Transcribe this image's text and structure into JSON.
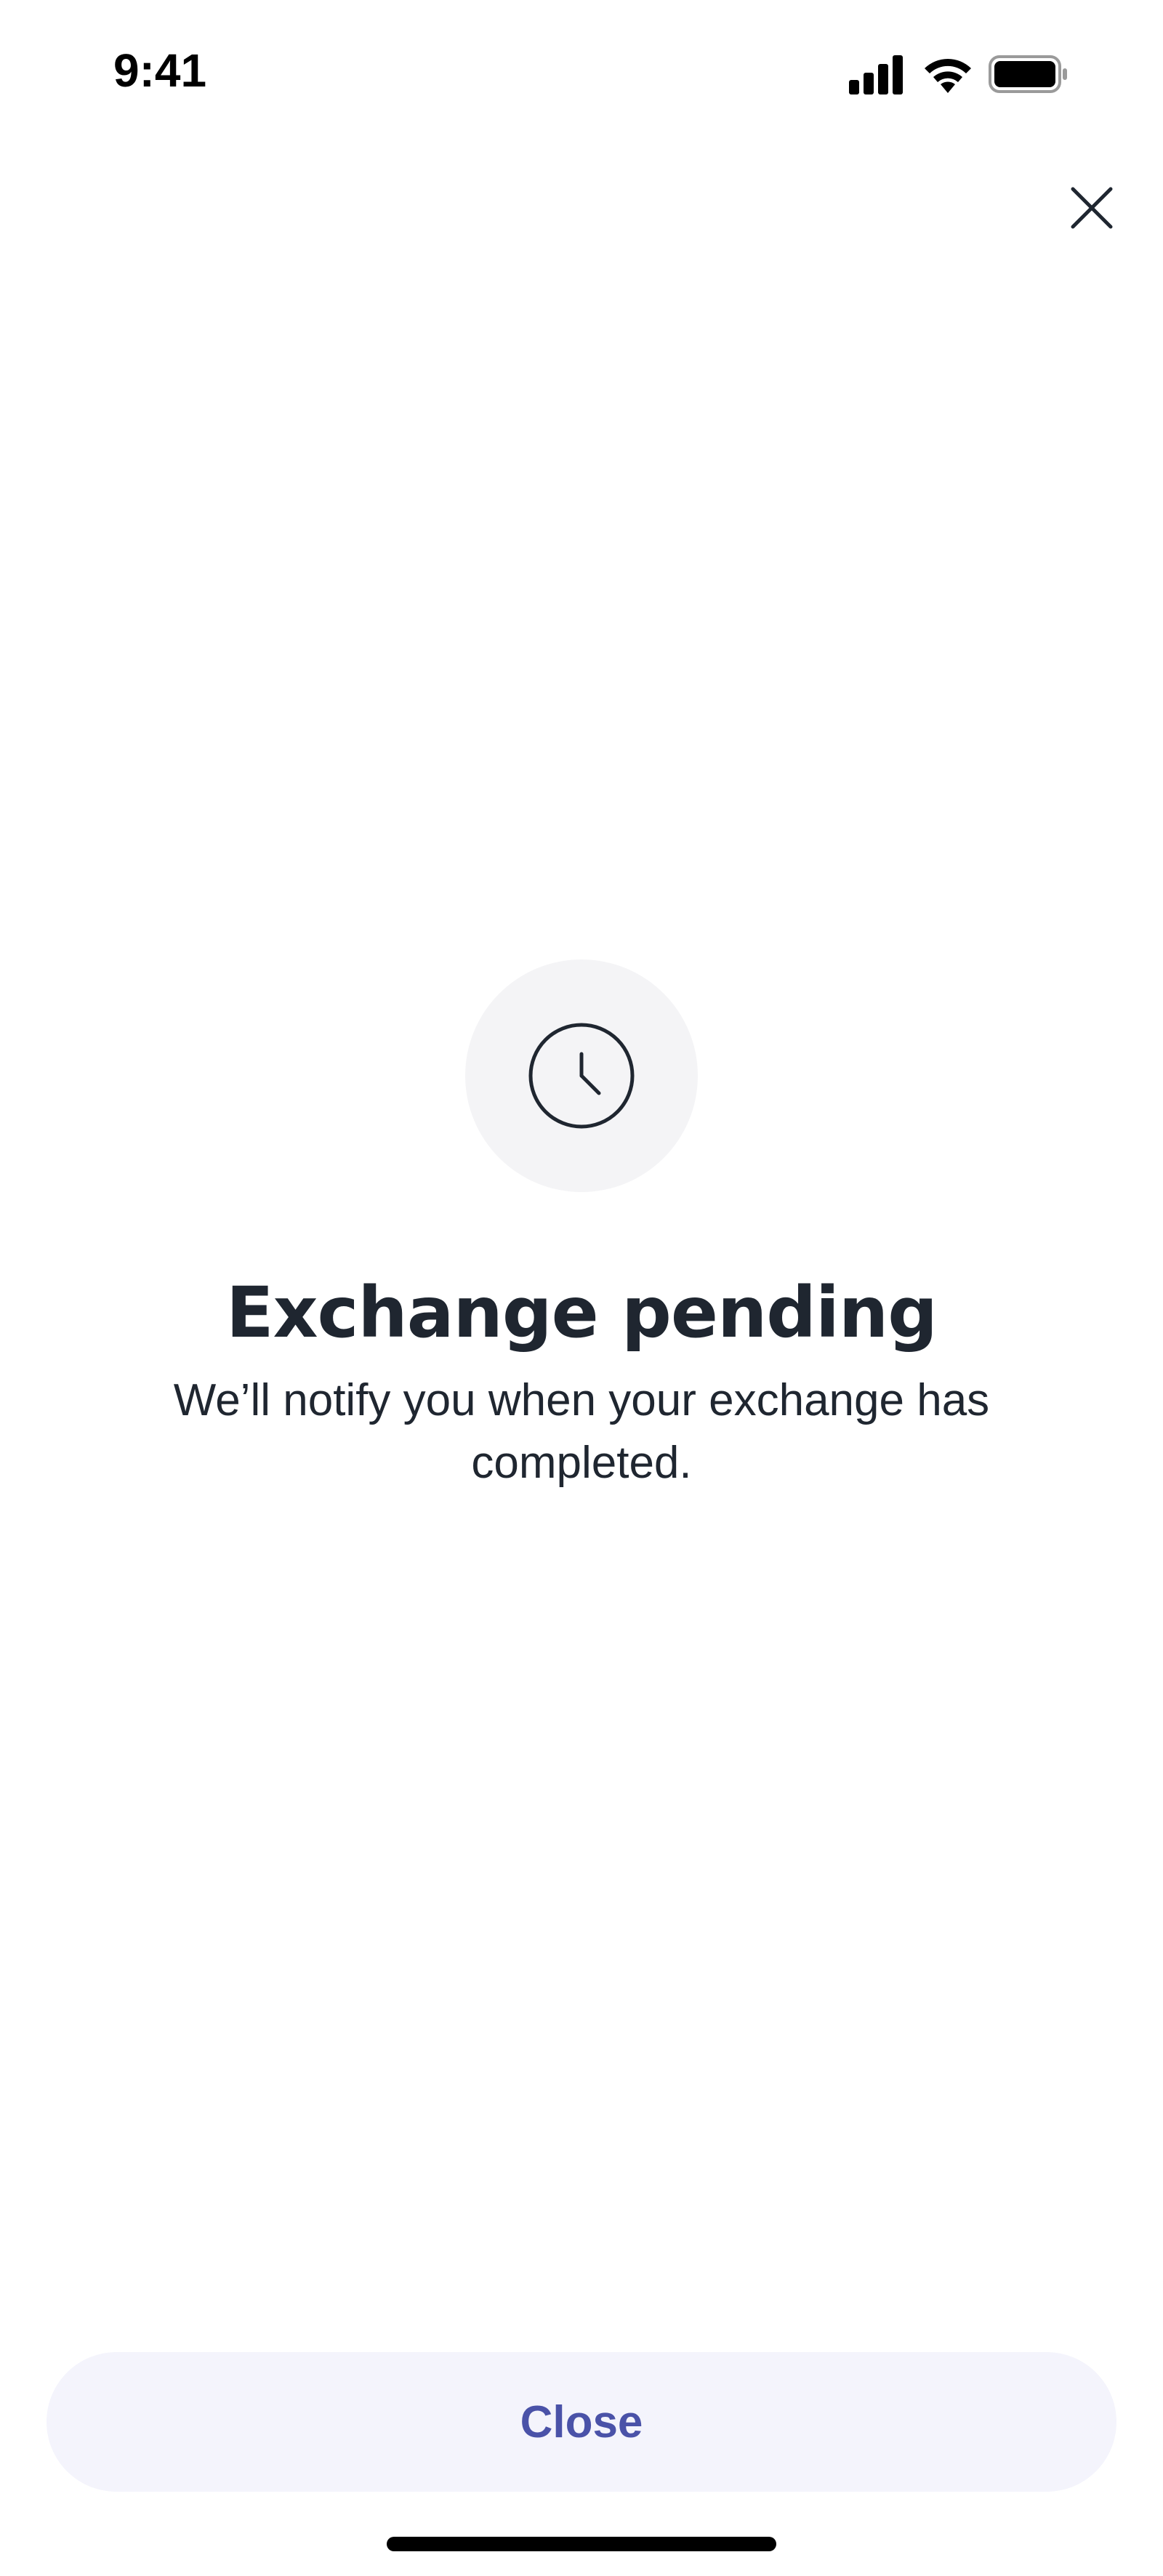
{
  "status_bar": {
    "time": "9:41",
    "icons": [
      "cellular-signal-icon",
      "wifi-icon",
      "battery-icon"
    ]
  },
  "header": {
    "close_icon": "close-icon"
  },
  "main": {
    "icon": "clock-icon",
    "title": "Exchange pending",
    "subtitle": "We’ll notify you when your exchange has completed."
  },
  "footer": {
    "close_label": "Close"
  },
  "colors": {
    "background": "#ffffff",
    "text_primary": "#1f2630",
    "icon_circle": "#f4f4f6",
    "button_bg": "#f4f4fc",
    "button_text": "#4a52a8"
  }
}
